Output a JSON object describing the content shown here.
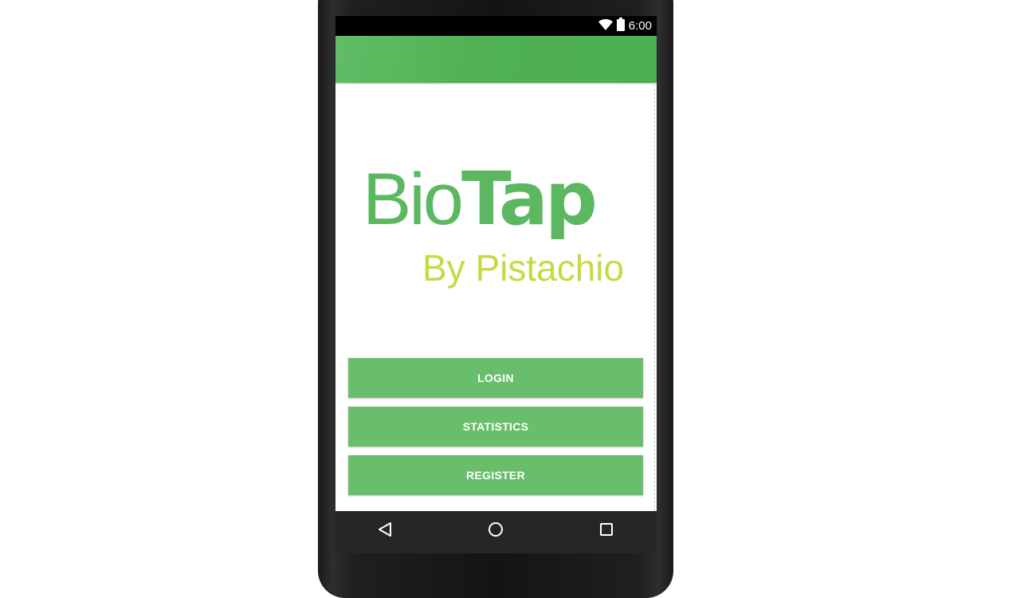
{
  "status_bar": {
    "time": "6:00",
    "icons": [
      "wifi-icon",
      "battery-icon"
    ],
    "color": "#000000"
  },
  "app_bar": {
    "color": "#4caf50"
  },
  "logo": {
    "light_text": "Bio",
    "bold_text": "Tap",
    "subtitle": "By Pistachio",
    "primary_color": "#5cb860",
    "subtitle_color": "#c8d944"
  },
  "buttons": {
    "login": "LOGIN",
    "statistics": "STATISTICS",
    "register": "REGISTER",
    "color": "#69be6c"
  },
  "nav_bar": {
    "icons": [
      "back-icon",
      "home-icon",
      "recents-icon"
    ]
  }
}
